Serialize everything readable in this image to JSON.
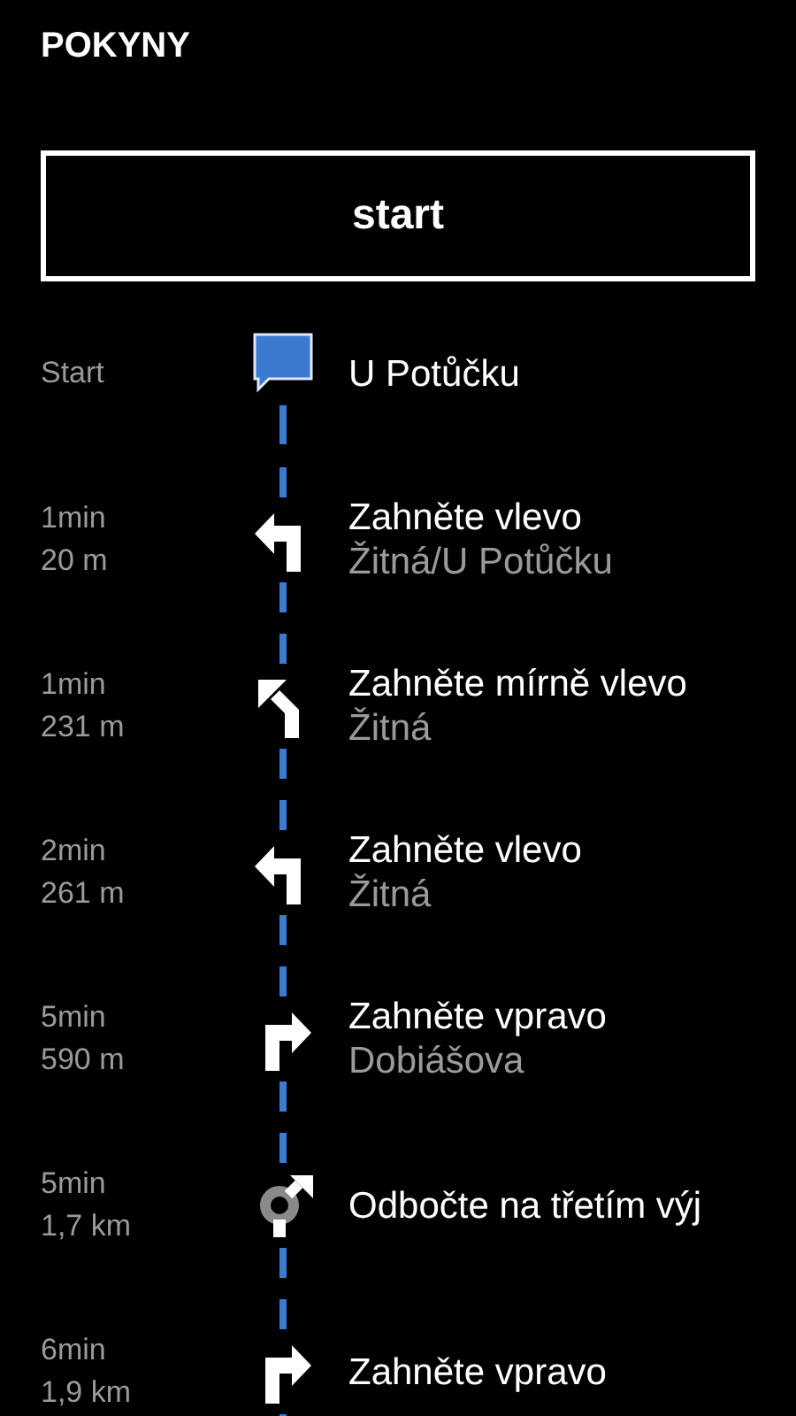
{
  "header": {
    "title": "POKYNY"
  },
  "start_button": {
    "label": "start"
  },
  "steps": [
    {
      "kind": "flag",
      "time": "Start",
      "instruction": "U Potůčku"
    },
    {
      "kind": "left",
      "time": "1min",
      "distance": "20 m",
      "instruction": "Zahněte vlevo",
      "street": "Žitná/U Potůčku"
    },
    {
      "kind": "slight-left",
      "time": "1min",
      "distance": "231 m",
      "instruction": "Zahněte mírně vlevo",
      "street": "Žitná"
    },
    {
      "kind": "left",
      "time": "2min",
      "distance": "261 m",
      "instruction": "Zahněte vlevo",
      "street": "Žitná"
    },
    {
      "kind": "right",
      "time": "5min",
      "distance": "590 m",
      "instruction": "Zahněte vpravo",
      "street": "Dobiášova"
    },
    {
      "kind": "roundabout",
      "time": "5min",
      "distance": "1,7 km",
      "instruction": "Odbočte na třetím výj"
    },
    {
      "kind": "right",
      "time": "6min",
      "distance": "1,9 km",
      "instruction": "Zahněte vpravo"
    }
  ]
}
